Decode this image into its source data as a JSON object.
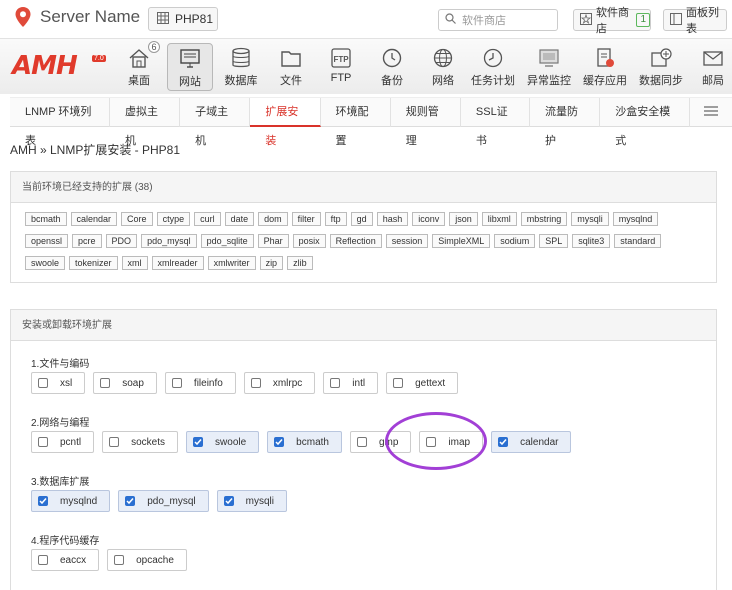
{
  "topbar": {
    "server_name": "Server Name",
    "php_label": "PHP81",
    "search_placeholder": "软件商店",
    "store_label": "软件商店",
    "store_count": "1",
    "panel_label": "面板列表"
  },
  "logo": {
    "text": "AMH",
    "version": "7.0"
  },
  "toolbar": {
    "items": [
      {
        "label": "桌面",
        "icon": "home-icon",
        "badge": "6"
      },
      {
        "label": "网站",
        "icon": "monitor-icon"
      },
      {
        "label": "数据库",
        "icon": "database-icon"
      },
      {
        "label": "文件",
        "icon": "folder-icon"
      },
      {
        "label": "FTP",
        "icon": "ftp-icon",
        "icon_text": "FTP"
      },
      {
        "label": "备份",
        "icon": "clock-backup-icon"
      },
      {
        "label": "网络",
        "icon": "globe-icon"
      },
      {
        "label": "任务计划",
        "icon": "schedule-icon"
      },
      {
        "label": "异常监控",
        "icon": "monitor-alert-icon"
      },
      {
        "label": "缓存应用",
        "icon": "cache-icon"
      },
      {
        "label": "数据同步",
        "icon": "sync-icon"
      },
      {
        "label": "邮局",
        "icon": "mail-icon"
      }
    ]
  },
  "nav": {
    "items": [
      "LNMP 环境列表",
      "虚拟主机",
      "子域主机",
      "扩展安装",
      "环境配置",
      "规则管理",
      "SSL证书",
      "流量防护",
      "沙盒安全模式"
    ],
    "active": "扩展安装"
  },
  "breadcrumb": "AMH » LNMP扩展安装 - PHP81",
  "supported": {
    "title": "当前环境已经支持的扩展",
    "count": "(38)",
    "rows": [
      [
        "bcmath",
        "calendar",
        "Core",
        "ctype",
        "curl",
        "date",
        "dom",
        "filter",
        "ftp",
        "gd",
        "hash",
        "iconv",
        "json",
        "libxml",
        "mbstring",
        "mysqli",
        "mysqlnd"
      ],
      [
        "openssl",
        "pcre",
        "PDO",
        "pdo_mysql",
        "pdo_sqlite",
        "Phar",
        "posix",
        "Reflection",
        "session",
        "SimpleXML",
        "sodium",
        "SPL",
        "sqlite3",
        "standard"
      ],
      [
        "swoole",
        "tokenizer",
        "xml",
        "xmlreader",
        "xmlwriter",
        "zip",
        "zlib"
      ]
    ]
  },
  "install": {
    "title": "安装或卸载环境扩展",
    "groups": [
      {
        "title": "1.文件与编码",
        "items": [
          {
            "label": "xsl",
            "checked": false
          },
          {
            "label": "soap",
            "checked": false
          },
          {
            "label": "fileinfo",
            "checked": false
          },
          {
            "label": "xmlrpc",
            "checked": false
          },
          {
            "label": "intl",
            "checked": false
          },
          {
            "label": "gettext",
            "checked": false
          }
        ]
      },
      {
        "title": "2.网络与编程",
        "items": [
          {
            "label": "pcntl",
            "checked": false
          },
          {
            "label": "sockets",
            "checked": false
          },
          {
            "label": "swoole",
            "checked": true
          },
          {
            "label": "bcmath",
            "checked": true
          },
          {
            "label": "gmp",
            "checked": false
          },
          {
            "label": "imap",
            "checked": false
          },
          {
            "label": "calendar",
            "checked": true
          }
        ]
      },
      {
        "title": "3.数据库扩展",
        "items": [
          {
            "label": "mysqlnd",
            "checked": true
          },
          {
            "label": "pdo_mysql",
            "checked": true
          },
          {
            "label": "mysqli",
            "checked": true
          }
        ]
      },
      {
        "title": "4.程序代码缓存",
        "items": [
          {
            "label": "eaccx",
            "checked": false
          },
          {
            "label": "opcache",
            "checked": false
          }
        ]
      }
    ]
  },
  "colors": {
    "accent": "#d9332a",
    "highlight": "#a23fd6",
    "check": "#2a6fd1"
  }
}
